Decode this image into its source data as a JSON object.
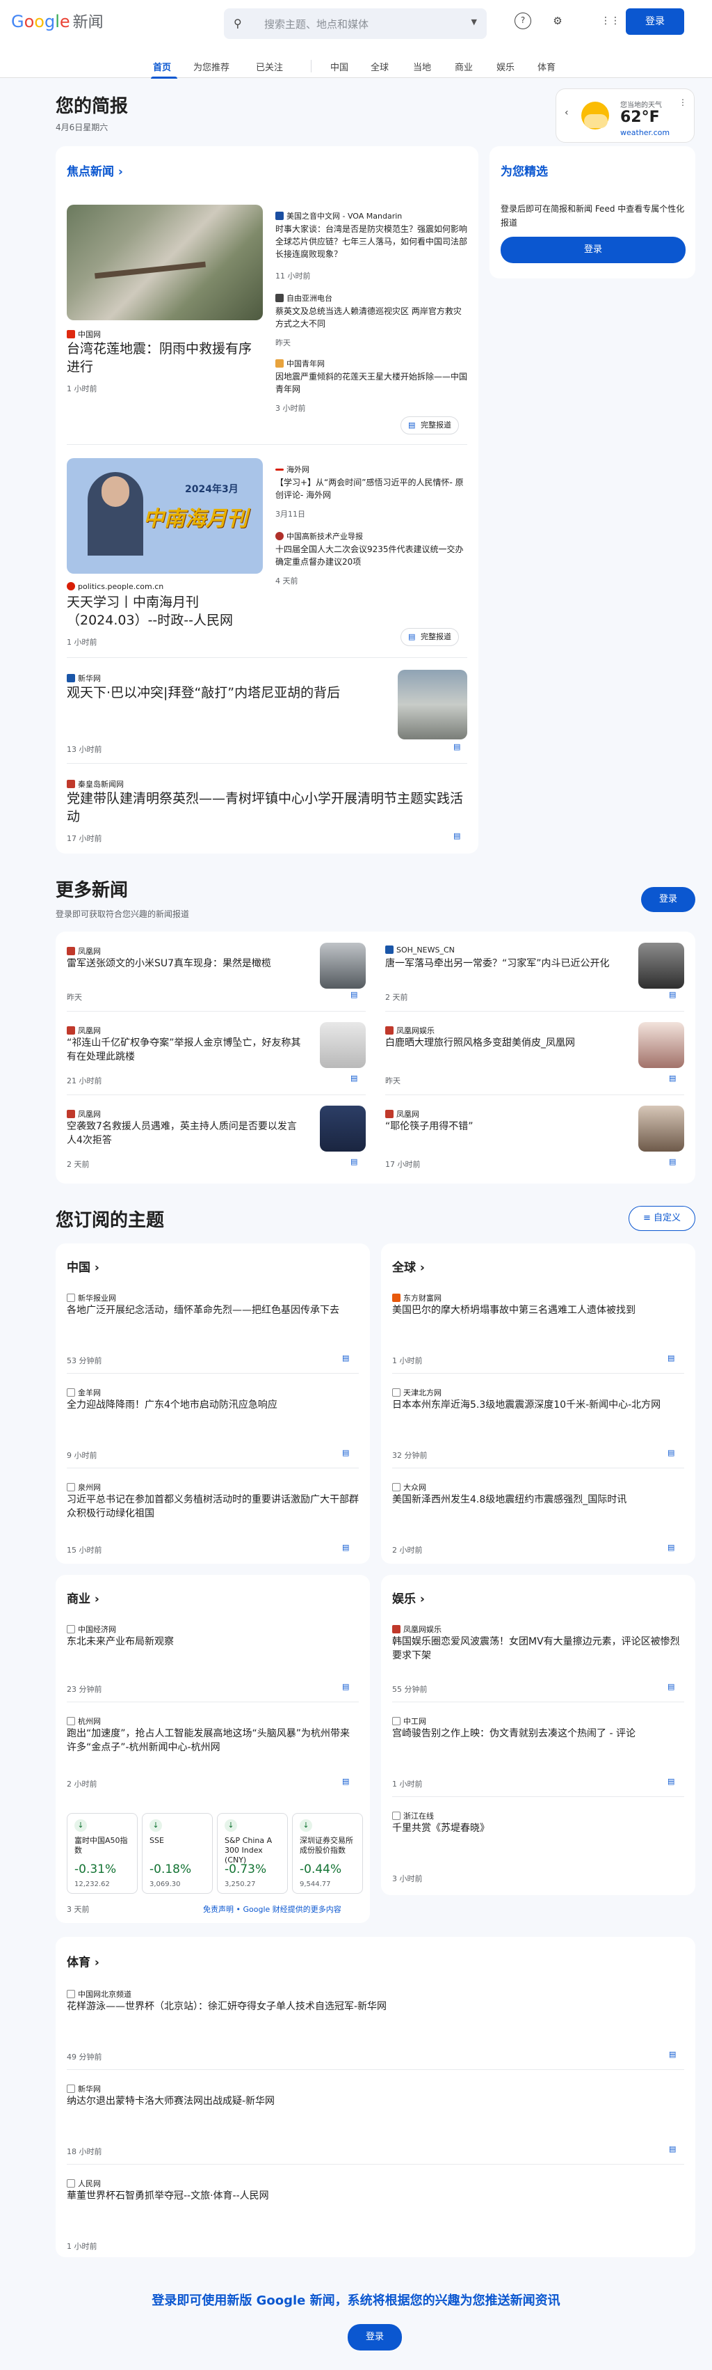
{
  "header": {
    "logo_google": "Google",
    "logo_news": "新闻",
    "search_placeholder": "搜索主题、地点和媒体",
    "signin": "登录"
  },
  "tabs": [
    "首页",
    "为您推荐",
    "已关注",
    "中国",
    "全球",
    "当地",
    "商业",
    "娱乐",
    "体育"
  ],
  "briefing": {
    "title": "您的简报",
    "date": "4月6日星期六"
  },
  "weather": {
    "location": "您当地的天气",
    "temp": "62°F",
    "source": "weather.com"
  },
  "top_stories": {
    "heading": "焦点新闻",
    "full_coverage": "完整报道",
    "s1": {
      "main_source": "中国网",
      "main_title": "台湾花莲地震：阴雨中救援有序进行",
      "main_time": "1 小时前",
      "side": [
        {
          "source": "美国之音中文网 - VOA Mandarin",
          "title": "时事大家谈：台湾是否是防灾模范生？强震如何影响全球芯片供应链？七年三人落马，如何看中国司法部长接连腐败现象？",
          "time": "11 小时前"
        },
        {
          "source": "自由亚洲电台",
          "title": "蔡英文及总统当选人赖清德巡视灾区 两岸官方救灾方式之大不同",
          "time": "昨天"
        },
        {
          "source": "中国青年网",
          "title": "因地震严重倾斜的花莲天王星大楼开始拆除——中国青年网",
          "time": "3 小时前"
        }
      ]
    },
    "s2": {
      "main_source": "politics.people.com.cn",
      "main_title": "天天学习丨中南海月刊（2024.03）--时政--人民网",
      "main_time": "1 小时前",
      "img_text1": "2024年3月",
      "img_text2": "中南海月刊",
      "side": [
        {
          "source": "海外网",
          "title": "【学习+】从“两会时间”感悟习近平的人民情怀- 原创评论- 海外网",
          "time": "3月11日"
        },
        {
          "source": "中国高新技术产业导报",
          "title": "十四届全国人大二次会议9235件代表建议统一交办确定重点督办建议20项",
          "time": "4 天前"
        }
      ]
    },
    "s3": {
      "source": "新华网",
      "title": "观天下·巴以冲突|拜登“敲打”内塔尼亚胡的背后",
      "time": "13 小时前"
    },
    "s4": {
      "source": "秦皇岛新闻网",
      "title": "党建带队建清明祭英烈——青树坪镇中心小学开展清明节主题实践活动",
      "time": "17 小时前"
    }
  },
  "picks": {
    "heading": "为您精选",
    "text": "登录后即可在简报和新闻 Feed 中查看专属个性化报道",
    "button": "登录"
  },
  "more": {
    "heading": "更多新闻",
    "sub": "登录即可获取符合您兴趣的新闻报道",
    "button": "登录",
    "items": [
      {
        "source": "凤凰网",
        "title": "雷军送张颂文的小米SU7真车现身：果然是橄榄",
        "time": "昨天"
      },
      {
        "source": "SOH_NEWS_CN",
        "title": "唐一军落马牵出另一常委？“习家军”内斗已近公开化",
        "time": "2 天前"
      },
      {
        "source": "凤凰网",
        "title": "“祁连山千亿矿权争夺案”举报人金京博坠亡，好友称其有在处理此跳楼",
        "time": "21 小时前"
      },
      {
        "source": "凤凰网娱乐",
        "title": "白鹿晒大理旅行照风格多变甜美俏皮_凤凰网",
        "time": "昨天"
      },
      {
        "source": "凤凰网",
        "title": "空袭致7名救援人员遇难，英主持人质问是否要以发言人4次拒答",
        "time": "2 天前"
      },
      {
        "source": "凤凰网",
        "title": "“耶伦筷子用得不错”",
        "time": "17 小时前"
      }
    ]
  },
  "topics": {
    "heading": "您订阅的主题",
    "customize": "自定义",
    "china": {
      "name": "中国",
      "items": [
        {
          "source": "新华报业网",
          "title": "各地广泛开展纪念活动，缅怀革命先烈——把红色基因传承下去",
          "time": "53 分钟前"
        },
        {
          "source": "金羊网",
          "title": "全力迎战降降雨！广东4个地市启动防汛应急响应",
          "time": "9 小时前"
        },
        {
          "source": "泉州网",
          "title": "习近平总书记在参加首都义务植树活动时的重要讲话激励广大干部群众积极行动绿化祖国",
          "time": "15 小时前"
        }
      ]
    },
    "world": {
      "name": "全球",
      "items": [
        {
          "source": "东方财富网",
          "title": "美国巴尔的摩大桥坍塌事故中第三名遇难工人遗体被找到",
          "time": "1 小时前"
        },
        {
          "source": "天津北方网",
          "title": "日本本州东岸近海5.3级地震震源深度10千米-新闻中心-北方网",
          "time": "32 分钟前"
        },
        {
          "source": "大众网",
          "title": "美国新泽西州发生4.8级地震纽约市震感强烈_国际时讯",
          "time": "2 小时前"
        }
      ]
    },
    "business": {
      "name": "商业",
      "items": [
        {
          "source": "中国经济网",
          "title": "东北未来产业布局新观察",
          "time": "23 分钟前"
        },
        {
          "source": "杭州网",
          "title": "跑出“加速度”，抢占人工智能发展高地这场“头脑风暴”为杭州带来许多“金点子”-杭州新闻中心-杭州网",
          "time": "2 小时前"
        }
      ],
      "stocks": [
        {
          "name": "富时中国A50指数",
          "pct": "-0.31%",
          "value": "12,232.62"
        },
        {
          "name": "SSE",
          "pct": "-0.18%",
          "value": "3,069.30"
        },
        {
          "name": "S&P China A 300 Index (CNY)",
          "pct": "-0.73%",
          "value": "3,250.27"
        },
        {
          "name": "深圳证券交易所成份股价指数",
          "pct": "-0.44%",
          "value": "9,544.77"
        }
      ],
      "stocks_time": "3 天前",
      "disclaimer": "免责声明 • Google 财经提供的更多内容"
    },
    "ent": {
      "name": "娱乐",
      "items": [
        {
          "source": "凤凰网娱乐",
          "title": "韩国娱乐圈恋爱风波震荡！女团MV有大量擦边元素，评论区被惨烈要求下架",
          "time": "55 分钟前"
        },
        {
          "source": "中工网",
          "title": "宫崎骏告别之作上映：伪文青就别去凑这个热闹了 - 评论",
          "time": "1 小时前"
        },
        {
          "source": "浙江在线",
          "title": "千里共赏《苏堤春晓》",
          "time": "3 小时前"
        }
      ]
    },
    "sports": {
      "name": "体育",
      "items": [
        {
          "source": "中国网北京频道",
          "title": "花样游泳——世界杯（北京站）：徐汇妍夺得女子单人技术自选冠军-新华网",
          "time": "49 分钟前"
        },
        {
          "source": "新华网",
          "title": "纳达尔退出蒙特卡洛大师赛法网出战成疑-新华网",
          "time": "18 小时前"
        },
        {
          "source": "人民网",
          "title": "華董世界杯石智勇抓举夺冠--文旅·体育--人民网",
          "time": "1 小时前"
        }
      ]
    }
  },
  "footer": {
    "text": "登录即可使用新版 Google 新闻，系统将根据您的兴趣为您推送新闻资讯",
    "button": "登录"
  }
}
